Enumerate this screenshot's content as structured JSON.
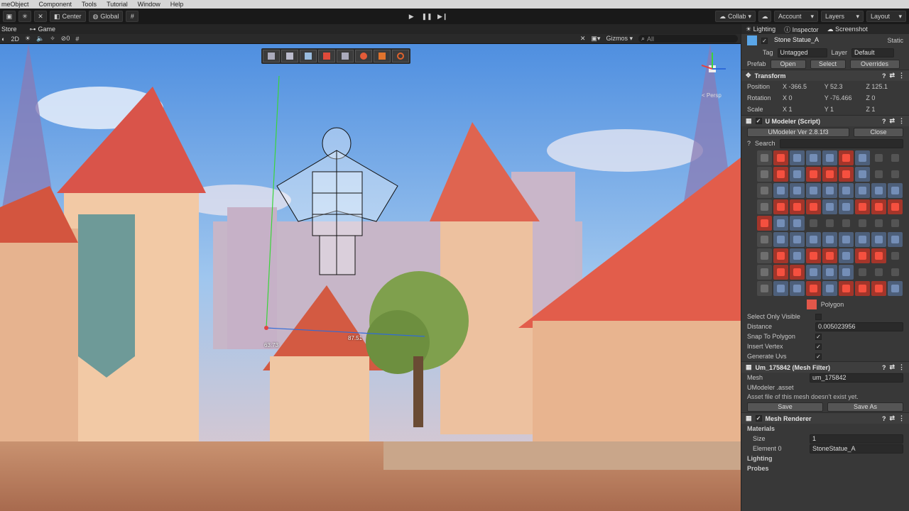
{
  "menubar": {
    "items": [
      "meObject",
      "Component",
      "Tools",
      "Tutorial",
      "Window",
      "Help"
    ]
  },
  "toolbar": {
    "center_label": "Center",
    "global_label": "Global",
    "collab_label": "Collab",
    "account_label": "Account",
    "layers_label": "Layers",
    "layout_label": "Layout"
  },
  "tabs": {
    "scene": "Store",
    "game": "Game"
  },
  "scene_toolbar": {
    "layers_count": "0",
    "gizmos_label": "Gizmos",
    "search_placeholder": "All"
  },
  "scene_overlay": {
    "length_a": "63.73",
    "length_b": "87.51",
    "persp_label": "< Persp"
  },
  "inspector": {
    "tabs": [
      "Lighting",
      "Inspector",
      "Screenshot"
    ],
    "object_name": "Stone Statue_A",
    "static_label": "Static",
    "tag_label": "Tag",
    "tag_value": "Untagged",
    "layer_label": "Layer",
    "layer_value": "Default",
    "prefab_label": "Prefab",
    "prefab_open": "Open",
    "prefab_select": "Select",
    "prefab_overrides": "Overrides",
    "transform": {
      "title": "Transform",
      "position_label": "Position",
      "rotation_label": "Rotation",
      "scale_label": "Scale",
      "position": {
        "x": "-366.5",
        "y": "52.3",
        "z": "125.1"
      },
      "rotation": {
        "x": "0",
        "y": "-76.466",
        "z": "0"
      },
      "scale": {
        "x": "1",
        "y": "1",
        "z": "1"
      }
    },
    "umodeler": {
      "title": "U Modeler (Script)",
      "version": "UModeler Ver 2.8.1f3",
      "close_label": "Close",
      "search_label": "Search",
      "polygon_label": "Polygon",
      "select_only_visible": "Select Only Visible",
      "distance_label": "Distance",
      "distance_value": "0.005023956",
      "snap_label": "Snap To Polygon",
      "insert_vertex_label": "Insert Vertex",
      "generate_uvs_label": "Generate Uvs"
    },
    "mesh_filter": {
      "title": "Um_175842 (Mesh Filter)",
      "mesh_label": "Mesh",
      "mesh_value": "um_175842",
      "asset_label": "UModeler .asset",
      "asset_note": "Asset file of this mesh doesn't exist yet.",
      "save_label": "Save",
      "save_as_label": "Save As"
    },
    "mesh_renderer": {
      "title": "Mesh Renderer",
      "materials_label": "Materials",
      "size_label": "Size",
      "size_value": "1",
      "element_label": "Element 0",
      "element_value": "StoneStatue_A",
      "lighting_label": "Lighting",
      "probes_label": "Probes"
    }
  },
  "colors": {
    "accent": "#3d7bd8",
    "toolbar_bg": "#191919",
    "panel_bg": "#383838"
  }
}
